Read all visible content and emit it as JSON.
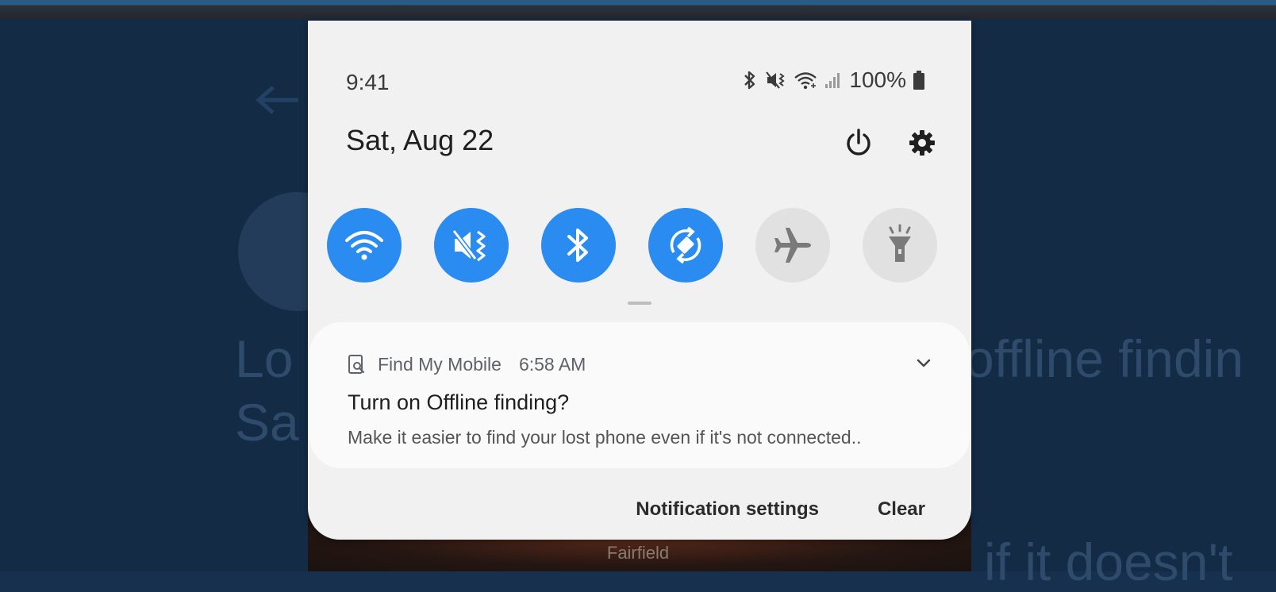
{
  "background": {
    "line1_left": "Lo",
    "line1_right": "offline findin",
    "line2_left": "Sa",
    "line3_right": "if it doesn't",
    "city": "Fairfield"
  },
  "status_bar": {
    "time": "9:41",
    "battery": "100%",
    "icons": [
      "bluetooth-icon",
      "mute-vibrate-icon",
      "wifi-icon",
      "signal-icon",
      "battery-icon"
    ]
  },
  "header": {
    "date": "Sat, Aug 22",
    "power_icon": "power-icon",
    "settings_icon": "gear-icon"
  },
  "quick_settings": [
    {
      "name": "Wi-Fi",
      "icon": "wifi-icon",
      "state": "on"
    },
    {
      "name": "Mute",
      "icon": "vibrate-icon",
      "state": "on"
    },
    {
      "name": "Bluetooth",
      "icon": "bluetooth-icon",
      "state": "on"
    },
    {
      "name": "Auto rotate",
      "icon": "auto-rotate-icon",
      "state": "on"
    },
    {
      "name": "Airplane mode",
      "icon": "airplane-icon",
      "state": "off"
    },
    {
      "name": "Flashlight",
      "icon": "flashlight-icon",
      "state": "off"
    }
  ],
  "notification": {
    "app_name": "Find My Mobile",
    "time": "6:58 AM",
    "title": "Turn on Offline finding?",
    "body": "Make it easier to find your lost phone even if it's not connected.."
  },
  "actions": {
    "notification_settings": "Notification settings",
    "clear": "Clear"
  },
  "colors": {
    "tile_on": "#2a8cf0",
    "tile_off": "#e1e1e2",
    "shade_bg": "#f1f1f2"
  }
}
